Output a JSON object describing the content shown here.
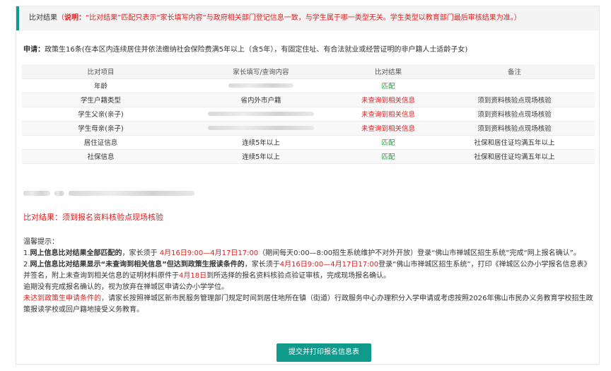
{
  "banner": {
    "title": "比对结果",
    "note_open": "（",
    "note_label": "说明：",
    "note_text": "“比对结果”匹配只表示“家长填写内容”与政府相关部门登记信息一致，与学生属于哪一类型无关。学生类型以教育部门最后审核结果为准。）"
  },
  "apply": {
    "label": "申请：",
    "text": "政策生16条(在本区内连续居住并依法缴纳社会保险费满5年以上（含5年），有固定住址、有合法就业或经营证明的非户籍人士适龄子女)"
  },
  "table": {
    "headers": [
      "比对项目",
      "家长填写/查询内容",
      "比对结果",
      "备注"
    ],
    "rows": [
      {
        "item": "年龄",
        "content": "",
        "result": "匹配",
        "result_type": "match",
        "note": ""
      },
      {
        "item": "学生户籍类型",
        "content": "省内外市户籍",
        "result": "未查询到相关信息",
        "result_type": "nomatch",
        "note": "须到资料核验点现场核验"
      },
      {
        "item": "学生父亲(亲子)",
        "content": "",
        "result": "未查询到相关信息",
        "result_type": "nomatch",
        "note": "须到资料核验点现场核验"
      },
      {
        "item": "学生母亲(亲子)",
        "content": "",
        "result": "未查询到相关信息",
        "result_type": "nomatch",
        "note": "须到资料核验点现场核验"
      },
      {
        "item": "居住证信息",
        "content": "连续5年以上",
        "result": "匹配",
        "result_type": "match",
        "note": "社保和居住证均满五年以上"
      },
      {
        "item": "社保信息",
        "content": "连续5年以上",
        "result": "匹配",
        "result_type": "match",
        "note": "社保和居住证均满五年以上"
      }
    ]
  },
  "result_text": "比对结果：须到报名资料核验点现场核验",
  "tips": {
    "title": "温馨提示：",
    "p1_num": "1.",
    "p1_bold": "网上信息比对结果全部匹配的",
    "p1_a": "，家长须于",
    "p1_date": " 4月16日9:00—4月17日17:00",
    "p1_b": "（期间每天0:00—8:00招生系统维护不对外开放）登录“佛山市禅城区招生系统”完成“网上报名确认”。",
    "p2_num": "2.",
    "p2_bold": "网上信息比对结果显示“未查询到相关信息”但达到政策生报读条件的",
    "p2_a": "，家长须于",
    "p2_date": "4月16日9:00—4月17日17:00",
    "p2_b": "登录“佛山市禅城区招生系统”，打印《禅城区公办小学报名信息表》并签名，附上未查询到相关信息的证明材料原件于",
    "p2_date2": "4月18日",
    "p2_c": "到所选择的报名资料核验点验证审核，完成现场报名确认。",
    "p3": "逾期没有完成报名确认的，视为放弃在禅城区申请公办小学学位。",
    "p4_red": "未达到政策生申请条件的，",
    "p4_text": "请家长按照禅城区新市民服务管理部门规定时间到居住地所在镇（街道）行政服务中心办理积分入学申请或考虑按照2026年佛山市民办义务教育学校招生政策报读学校或回户籍地接受义务教育。"
  },
  "button_label": "提交并打印报名信息表",
  "colors": {
    "accent": "#0f9a8c",
    "match": "#1e9b3a",
    "nomatch": "#e02020"
  }
}
